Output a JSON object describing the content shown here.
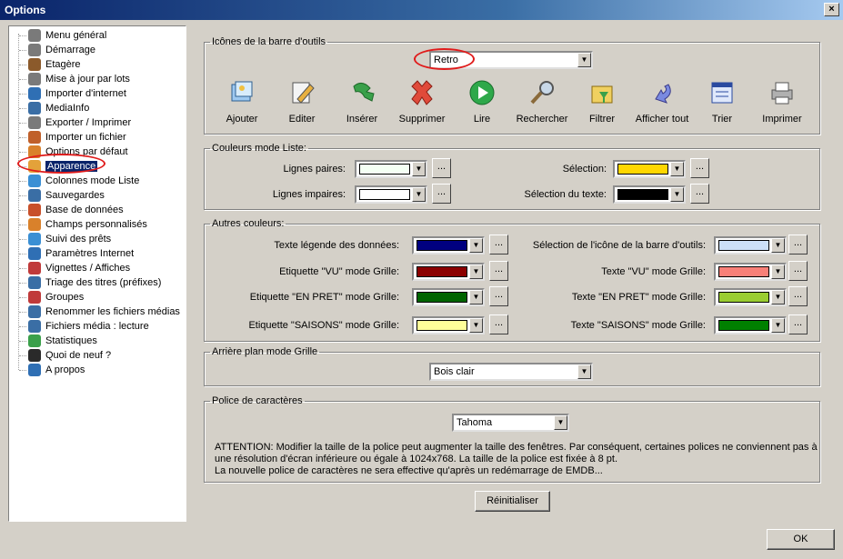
{
  "window": {
    "title": "Options",
    "close_label": "×"
  },
  "tree": {
    "items": [
      {
        "label": "Menu général",
        "icon": "gear-icon",
        "color": "#7a7a7a"
      },
      {
        "label": "Démarrage",
        "icon": "gear-icon",
        "color": "#7a7a7a"
      },
      {
        "label": "Etagère",
        "icon": "shelf-icon",
        "color": "#8b5a2b"
      },
      {
        "label": "Mise à jour par lots",
        "icon": "gear-icon",
        "color": "#7a7a7a"
      },
      {
        "label": "Importer d'internet",
        "icon": "globe-icon",
        "color": "#2f6fb4"
      },
      {
        "label": "MediaInfo",
        "icon": "info-icon",
        "color": "#3a6ea5"
      },
      {
        "label": "Exporter / Imprimer",
        "icon": "gear-icon",
        "color": "#7a7a7a"
      },
      {
        "label": "Importer un fichier",
        "icon": "import-icon",
        "color": "#c0602a"
      },
      {
        "label": "Options par défaut",
        "icon": "user-icon",
        "color": "#d9812b"
      },
      {
        "label": "Apparence",
        "icon": "palette-icon",
        "color": "#e3a23a"
      },
      {
        "label": "Colonnes mode Liste",
        "icon": "columns-icon",
        "color": "#3a8fd4"
      },
      {
        "label": "Sauvegardes",
        "icon": "save-icon",
        "color": "#3a6ea5"
      },
      {
        "label": "Base de données",
        "icon": "database-icon",
        "color": "#c8502a"
      },
      {
        "label": "Champs personnalisés",
        "icon": "user-icon",
        "color": "#d9812b"
      },
      {
        "label": "Suivi des prêts",
        "icon": "loan-icon",
        "color": "#3a8fd4"
      },
      {
        "label": "Paramètres Internet",
        "icon": "globe-icon",
        "color": "#2f6fb4"
      },
      {
        "label": "Vignettes / Affiches",
        "icon": "thumbnails-icon",
        "color": "#c03a3a"
      },
      {
        "label": "Triage des titres (préfixes)",
        "icon": "sort-icon",
        "color": "#3a6ea5"
      },
      {
        "label": "Groupes",
        "icon": "group-icon",
        "color": "#c03a3a"
      },
      {
        "label": "Renommer les fichiers médias",
        "icon": "rename-icon",
        "color": "#3a6ea5"
      },
      {
        "label": "Fichiers média : lecture",
        "icon": "media-icon",
        "color": "#3a6ea5"
      },
      {
        "label": "Statistiques",
        "icon": "stats-icon",
        "color": "#3aa04a"
      },
      {
        "label": "Quoi de neuf ?",
        "icon": "news-icon",
        "color": "#2a2a2a"
      },
      {
        "label": "A propos",
        "icon": "about-icon",
        "color": "#2f6fb4"
      }
    ]
  },
  "toolbar_icons": {
    "legend": "Icônes de la barre d'outils",
    "theme_value": "Retro",
    "buttons": [
      {
        "label": "Ajouter",
        "icon": "add-icon"
      },
      {
        "label": "Editer",
        "icon": "edit-icon"
      },
      {
        "label": "Insérer",
        "icon": "insert-icon"
      },
      {
        "label": "Supprimer",
        "icon": "delete-icon"
      },
      {
        "label": "Lire",
        "icon": "play-icon"
      },
      {
        "label": "Rechercher",
        "icon": "search-icon"
      },
      {
        "label": "Filtrer",
        "icon": "filter-icon"
      },
      {
        "label": "Afficher tout",
        "icon": "show-all-icon"
      },
      {
        "label": "Trier",
        "icon": "sort-icon"
      },
      {
        "label": "Imprimer",
        "icon": "print-icon"
      }
    ]
  },
  "list_colors": {
    "legend": "Couleurs mode Liste:",
    "lines_even": {
      "label": "Lignes paires:",
      "color": "#f4fff4"
    },
    "lines_odd": {
      "label": "Lignes impaires:",
      "color": "#ffffff"
    },
    "selection": {
      "label": "Sélection:",
      "color": "#ffd700"
    },
    "selection_text": {
      "label": "Sélection du texte:",
      "color": "#000000"
    }
  },
  "other_colors": {
    "legend": "Autres couleurs:",
    "left": [
      {
        "label": "Texte légende des données:",
        "color": "#000080"
      },
      {
        "label": "Etiquette \"VU\" mode Grille:",
        "color": "#8b0000"
      },
      {
        "label": "Etiquette \"EN PRET\" mode Grille:",
        "color": "#006400"
      },
      {
        "label": "Etiquette \"SAISONS\" mode Grille:",
        "color": "#ffff99"
      }
    ],
    "right": [
      {
        "label": "Sélection de l'icône de la barre d'outils:",
        "color": "#cce0f8"
      },
      {
        "label": "Texte \"VU\" mode Grille:",
        "color": "#f88078"
      },
      {
        "label": "Texte \"EN PRET\" mode Grille:",
        "color": "#9acd32"
      },
      {
        "label": "Texte \"SAISONS\" mode Grille:",
        "color": "#008000"
      }
    ]
  },
  "grid_background": {
    "legend": "Arrière plan mode Grille",
    "value": "Bois clair"
  },
  "font": {
    "legend": "Police de caractères",
    "value": "Tahoma",
    "attention_lines": [
      "ATTENTION: Modifier la taille de la police peut augmenter la taille des fenêtres. Par conséquent, certaines polices ne conviennent pas à",
      "une résolution d'écran inférieure ou égale à 1024x768. La taille de la police est fixée à 8 pt.",
      "La nouvelle police de caractères ne sera effective qu'après un redémarrage de EMDB..."
    ]
  },
  "buttons": {
    "reset": "Réinitialiser",
    "ok": "OK",
    "dots": "..."
  }
}
